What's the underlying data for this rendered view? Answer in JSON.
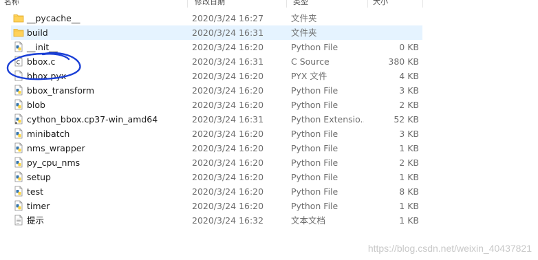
{
  "header": {
    "columns": [
      "名称",
      "修改日期",
      "类型",
      "大小"
    ]
  },
  "files": [
    {
      "name": "__pycache__",
      "date": "2020/3/24 16:27",
      "type": "文件夹",
      "size": "",
      "icon": "folder-icon"
    },
    {
      "name": "build",
      "date": "2020/3/24 16:31",
      "type": "文件夹",
      "size": "",
      "icon": "folder-icon",
      "selected": true
    },
    {
      "name": "__init__",
      "date": "2020/3/24 16:20",
      "type": "Python File",
      "size": "0 KB",
      "icon": "python-file-icon"
    },
    {
      "name": "bbox.c",
      "date": "2020/3/24 16:31",
      "type": "C Source",
      "size": "380 KB",
      "icon": "c-source-file-icon"
    },
    {
      "name": "bbox.pyx",
      "date": "2020/3/24 16:20",
      "type": "PYX 文件",
      "size": "4 KB",
      "icon": "blank-file-icon"
    },
    {
      "name": "bbox_transform",
      "date": "2020/3/24 16:20",
      "type": "Python File",
      "size": "3 KB",
      "icon": "python-file-icon"
    },
    {
      "name": "blob",
      "date": "2020/3/24 16:20",
      "type": "Python File",
      "size": "2 KB",
      "icon": "python-file-icon"
    },
    {
      "name": "cython_bbox.cp37-win_amd64",
      "date": "2020/3/24 16:31",
      "type": "Python Extensio...",
      "size": "52 KB",
      "icon": "python-extension-icon"
    },
    {
      "name": "minibatch",
      "date": "2020/3/24 16:20",
      "type": "Python File",
      "size": "3 KB",
      "icon": "python-file-icon"
    },
    {
      "name": "nms_wrapper",
      "date": "2020/3/24 16:20",
      "type": "Python File",
      "size": "1 KB",
      "icon": "python-file-icon"
    },
    {
      "name": "py_cpu_nms",
      "date": "2020/3/24 16:20",
      "type": "Python File",
      "size": "2 KB",
      "icon": "python-file-icon"
    },
    {
      "name": "setup",
      "date": "2020/3/24 16:20",
      "type": "Python File",
      "size": "1 KB",
      "icon": "python-file-icon"
    },
    {
      "name": "test",
      "date": "2020/3/24 16:20",
      "type": "Python File",
      "size": "8 KB",
      "icon": "python-file-icon"
    },
    {
      "name": "timer",
      "date": "2020/3/24 16:20",
      "type": "Python File",
      "size": "1 KB",
      "icon": "python-file-icon"
    },
    {
      "name": "提示",
      "date": "2020/3/24 16:32",
      "type": "文本文档",
      "size": "1 KB",
      "icon": "text-document-icon"
    }
  ],
  "watermark": "https://blog.csdn.net/weixin_40437821",
  "colors": {
    "selection": "#e5f3ff",
    "folder": "#ffd25a",
    "annotation": "#1a3fd6",
    "python_blue": "#3776ab",
    "python_yellow": "#ffd43b"
  }
}
